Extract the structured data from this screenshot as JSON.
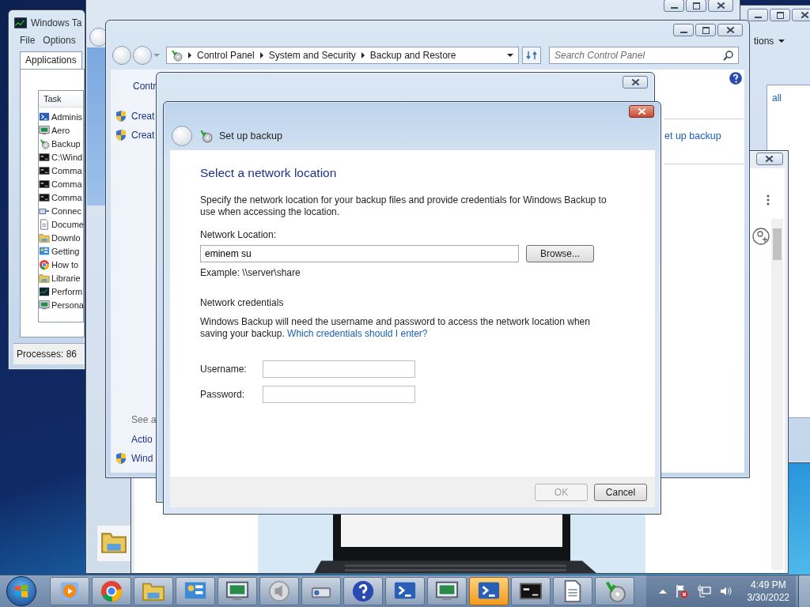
{
  "right_window": {
    "menu": "tions",
    "link": "all"
  },
  "task_manager": {
    "title": "Windows Ta",
    "menu": [
      "File",
      "Options"
    ],
    "tabs": [
      {
        "label": "Applications",
        "selected": true
      }
    ],
    "column": "Task",
    "tasks": [
      {
        "label": "Adminis",
        "kind": "terminal"
      },
      {
        "label": "Aero",
        "kind": "display"
      },
      {
        "label": "Backup",
        "kind": "backup"
      },
      {
        "label": "C:\\Wind",
        "kind": "console"
      },
      {
        "label": "Comma",
        "kind": "console"
      },
      {
        "label": "Comma",
        "kind": "console"
      },
      {
        "label": "Comma",
        "kind": "console"
      },
      {
        "label": "Connec",
        "kind": "network"
      },
      {
        "label": "Docume",
        "kind": "document"
      },
      {
        "label": "Downlo",
        "kind": "folder"
      },
      {
        "label": "Getting",
        "kind": "panel"
      },
      {
        "label": "How to",
        "kind": "browser"
      },
      {
        "label": "Librarie",
        "kind": "folder"
      },
      {
        "label": "Perform",
        "kind": "chart"
      },
      {
        "label": "Persona",
        "kind": "display"
      }
    ],
    "status": "Processes: 86"
  },
  "control_panel": {
    "breadcrumb": [
      "Control Panel",
      "System and Security",
      "Backup and Restore"
    ],
    "search": {
      "placeholder": "Search Control Panel"
    },
    "sidebar_heading": "Contr",
    "sidebar_links": [
      {
        "text": "Creat",
        "shield": true
      },
      {
        "text": "Creat",
        "shield": true
      }
    ],
    "see_also": "See a",
    "see_also_links": [
      {
        "text": "Actio",
        "shield": false
      },
      {
        "text": "Wind",
        "shield": true
      }
    ],
    "main_link": "et up backup"
  },
  "dialog": {
    "title": "Set up backup",
    "heading": "Select a network location",
    "description": "Specify the network location for your backup files and provide credentials for Windows Backup to use when accessing the location.",
    "location_label": "Network Location:",
    "location_value": "eminem su",
    "browse": "Browse...",
    "example": "Example: \\\\server\\share",
    "credentials_heading": "Network credentials",
    "credentials_text": "Windows Backup will need the username and password to access the network location when saving your backup.",
    "credentials_link": "Which credentials should I enter?",
    "fields": [
      {
        "label": "Username:"
      },
      {
        "label": "Password:"
      }
    ],
    "buttons": [
      {
        "label": "OK",
        "disabled": true
      },
      {
        "label": "Cancel",
        "disabled": false
      }
    ]
  },
  "taskbar": {
    "items": [
      {
        "kind": "media",
        "active": false
      },
      {
        "kind": "browser",
        "active": false
      },
      {
        "kind": "folder",
        "active": false
      },
      {
        "kind": "panel",
        "active": false
      },
      {
        "kind": "display",
        "active": false
      },
      {
        "kind": "speaker",
        "active": false
      },
      {
        "kind": "projector",
        "active": false
      },
      {
        "kind": "help",
        "active": false
      },
      {
        "kind": "terminal",
        "active": false
      },
      {
        "kind": "monitor",
        "active": false
      },
      {
        "kind": "terminal",
        "active": true
      },
      {
        "kind": "console",
        "active": false
      },
      {
        "kind": "document",
        "active": false
      },
      {
        "kind": "backup",
        "active": false
      }
    ],
    "time": "4:49 PM",
    "date": "3/30/2022"
  }
}
